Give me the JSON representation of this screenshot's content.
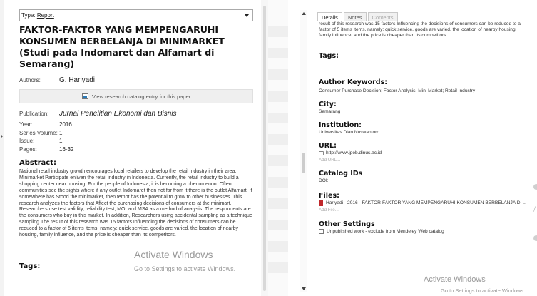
{
  "left": {
    "type_label": "Type:",
    "type_value": "Report",
    "title": "FAKTOR-FAKTOR YANG MEMPENGARUHI KONSUMEN BERBELANJA DI MINIMARKET (Studi pada Indomaret dan Alfamart di Semarang)",
    "authors_label": "Authors:",
    "authors_value": "G. Hariyadi",
    "catalog_button": "View research catalog entry for this paper",
    "publication_label": "Publication:",
    "publication_value": "Jurnal Penelitian Ekonomi dan Bisnis",
    "year_label": "Year:",
    "year_value": "2016",
    "series_label": "Series Volume:",
    "series_value": "1",
    "issue_label": "Issue:",
    "issue_value": "1",
    "pages_label": "Pages:",
    "pages_value": "16-32",
    "abstract_heading": "Abstract:",
    "abstract_text": "National retail industry growth encourages local retailers to develop the retail industry in their area. Minimarket Participate enliven the retail industry in Indonesia. Currently, the retail industry to build a shopping center near housing. For the people of Indonesia, it is becoming a phenomenon. Often communities see the sights where if any outlet Indomaret then not far from it there is the outlet Alfamart. If somewhere has Stood the minimarket, then tempt has the potential to grow to other businesses. This research analyzes the factors that Affect the purchasing decisions of consumers at the minimart. Researchers use test validity, reliability test, MO, and MSA as a method of analysis. The respondents are the consumers who buy in this market. In addition, Researchers using accidental sampling as a technique sampling.The result of this research was 15 factors Influencing the decisions of consumers can be reduced to a factor of 5 items items, namely: quick service, goods are varied, the location of nearby housing, family influence, and the price is cheaper than its competitors.",
    "tags_heading": "Tags:"
  },
  "watermark_left": {
    "line1": "Activate Windows",
    "line2": "Go to Settings to activate Windows."
  },
  "right": {
    "tabs": [
      "Details",
      "Notes",
      "Contents"
    ],
    "abstract_tail": "result of this research was 15 factors Influencing the decisions of consumers can be reduced to a factor of 5 items items, namely: quick service, goods are varied, the location of nearby housing, family influence, and the price is cheaper than its competitors.",
    "tags_heading": "Tags:",
    "author_keywords_heading": "Author Keywords:",
    "author_keywords_value": "Consumer Purchase Decision; Factor Analysis; Mini Market; Retail Industry",
    "city_heading": "City:",
    "city_value": "Semarang",
    "institution_heading": "Institution:",
    "institution_value": "Universitas Dian Nuswantoro",
    "url_heading": "URL:",
    "url_value": "http://www.jpeb.dinus.ac.id",
    "add_url": "Add URL...",
    "catalog_heading": "Catalog IDs",
    "doi_value": "DOI:",
    "files_heading": "Files:",
    "file_value": "Hariyadi - 2016 - FAKTOR-FAKTOR YANG MEMPENGARUHI KONSUMEN BERBELANJA DI ...",
    "add_file": "Add File...",
    "other_heading": "Other Settings",
    "unpublished_label": "Unpublished work - exclude from Mendeley Web catalog"
  },
  "watermark_right": {
    "line1": "Activate Windows",
    "line2": "Go to Settings to activate Windows"
  }
}
